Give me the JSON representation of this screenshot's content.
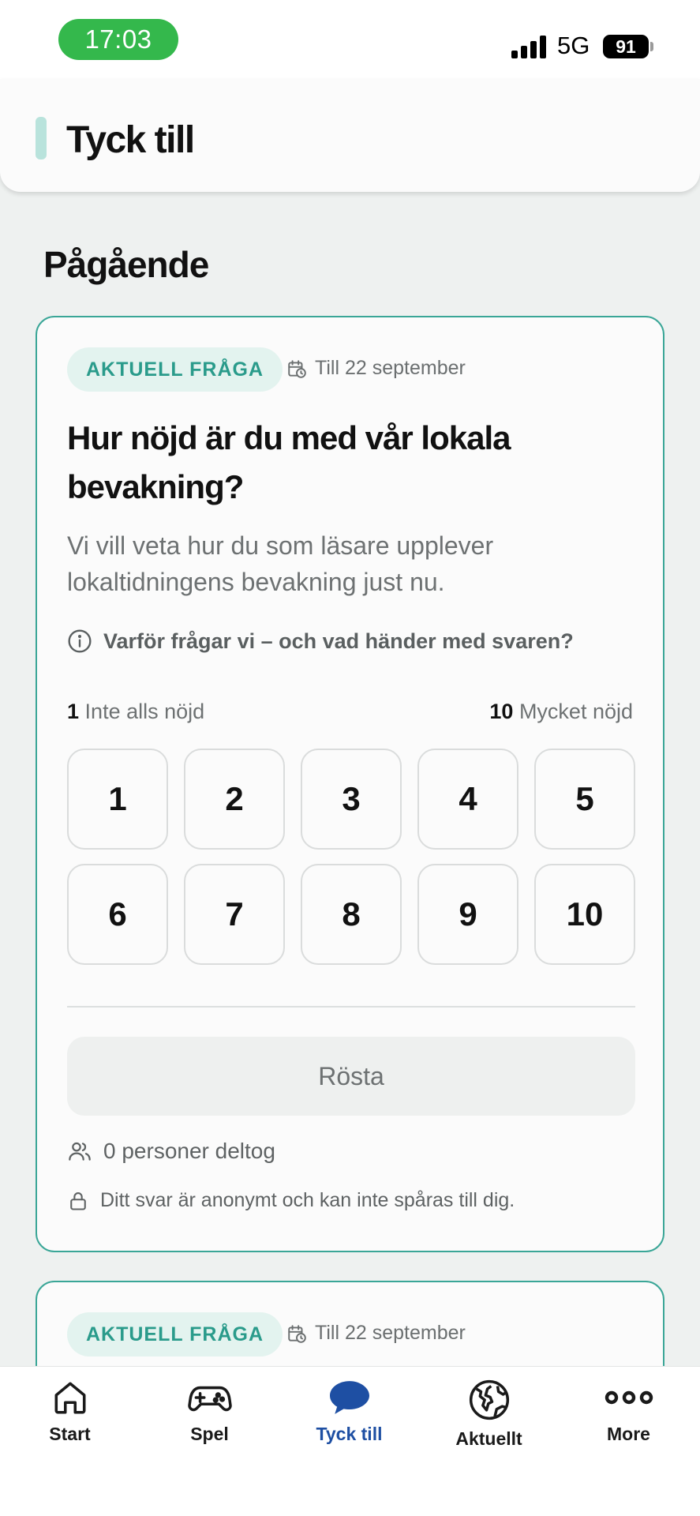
{
  "status_bar": {
    "time": "17:03",
    "network": "5G",
    "battery": "91"
  },
  "header": {
    "title": "Tyck till"
  },
  "section": {
    "title": "Pågående"
  },
  "card": {
    "badge": "AKTUELL FRÅGA",
    "date": "Till 22 september",
    "question": "Hur nöjd är du med vår lokala bevakning?",
    "description": "Vi vill veta hur du som läsare upplever lokaltidningens bevakning just nu.",
    "why_link": "Varför frågar vi – och vad händer med svaren?",
    "scale_low_num": "1",
    "scale_low_label": "Inte alls nöjd",
    "scale_high_num": "10",
    "scale_high_label": "Mycket nöjd",
    "options": [
      "1",
      "2",
      "3",
      "4",
      "5",
      "6",
      "7",
      "8",
      "9",
      "10"
    ],
    "vote_label": "Rösta",
    "participants": "0 personer deltog",
    "anonymous_note": "Ditt svar är anonymt och kan inte spåras till dig."
  },
  "card2": {
    "badge": "AKTUELL FRÅGA",
    "date": "Till 22 september"
  },
  "bottom_nav": {
    "items": [
      {
        "label": "Start",
        "icon": "home-icon"
      },
      {
        "label": "Spel",
        "icon": "gamepad-icon"
      },
      {
        "label": "Tyck till",
        "icon": "chat-bubble-icon",
        "active": true
      },
      {
        "label": "Aktuellt",
        "icon": "globe-icon"
      },
      {
        "label": "More",
        "icon": "more-dots-icon"
      }
    ]
  },
  "colors": {
    "accent": "#3aa697",
    "active_nav": "#1e4fa3",
    "time_pill": "#34b84c"
  }
}
